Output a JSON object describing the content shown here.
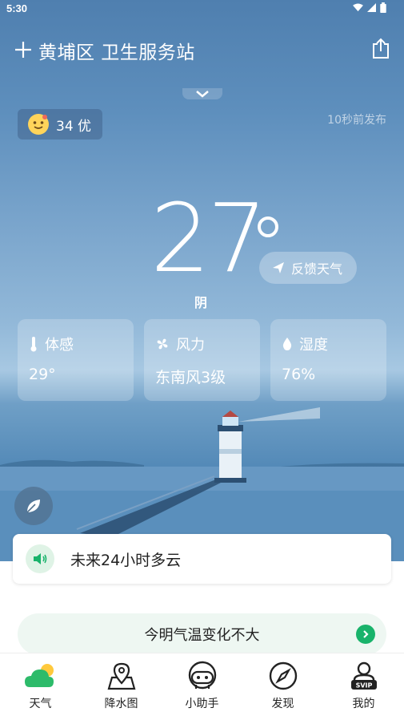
{
  "status": {
    "time": "5:30"
  },
  "header": {
    "location": "黄埔区 卫生服务站"
  },
  "aqi": {
    "value": "34 优"
  },
  "published": "10秒前发布",
  "weather": {
    "temperature": "27",
    "condition": "阴"
  },
  "feedback": {
    "label": "反馈天气"
  },
  "metrics": [
    {
      "label": "体感",
      "value": "29°",
      "icon": "thermometer-icon"
    },
    {
      "label": "风力",
      "value": "东南风3级",
      "icon": "fan-icon"
    },
    {
      "label": "湿度",
      "value": "76%",
      "icon": "droplet-icon"
    }
  ],
  "announcement": {
    "text": "未来24小时多云"
  },
  "tip": {
    "text": "今明气温变化不大"
  },
  "tabs": [
    {
      "label": "天气",
      "icon": "weather-icon"
    },
    {
      "label": "降水图",
      "icon": "map-pin-icon"
    },
    {
      "label": "小助手",
      "icon": "robot-icon"
    },
    {
      "label": "发现",
      "icon": "compass-icon"
    },
    {
      "label": "我的",
      "icon": "svip-user-icon"
    }
  ],
  "colors": {
    "accent": "#19b36b",
    "sky": "#5e8fbd"
  }
}
